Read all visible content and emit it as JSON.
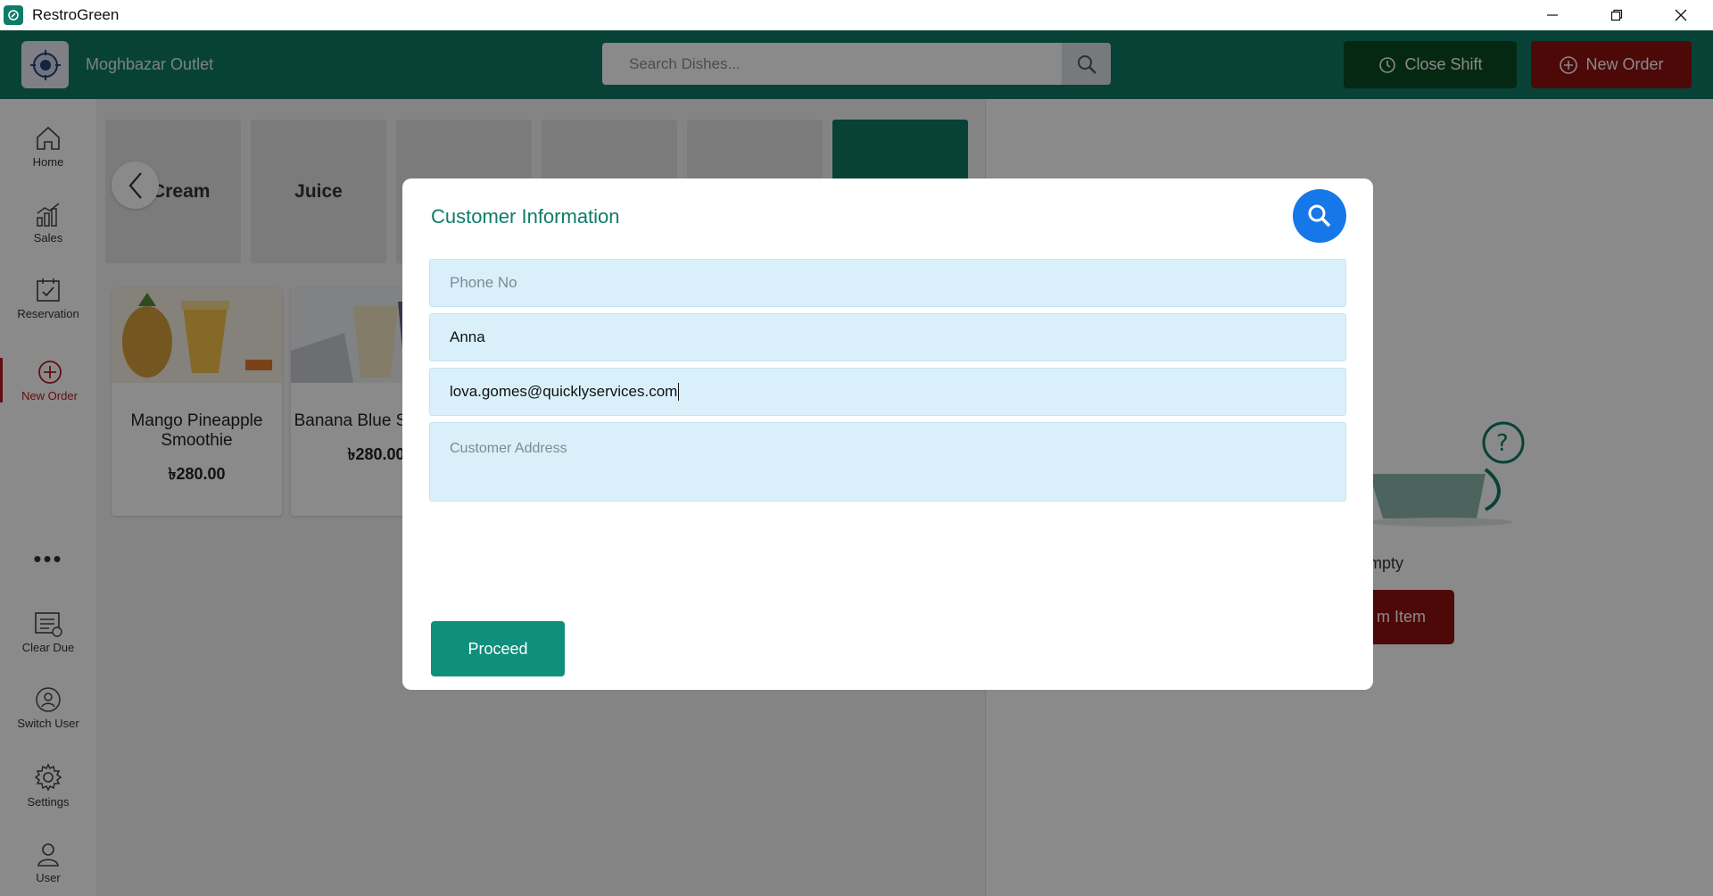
{
  "window": {
    "title": "RestroGreen",
    "controls": [
      "minimize",
      "restore",
      "close"
    ]
  },
  "header": {
    "outlet_name": "Moghbazar Outlet",
    "search_placeholder": "Search Dishes...",
    "close_shift_label": "Close Shift",
    "new_order_label": "New Order"
  },
  "sidebar": {
    "items": [
      {
        "label": "Home",
        "icon": "home-icon"
      },
      {
        "label": "Sales",
        "icon": "chart-icon"
      },
      {
        "label": "Reservation",
        "icon": "calendar-check-icon"
      },
      {
        "label": "New Order",
        "icon": "plus-circle-icon",
        "active": true
      },
      {
        "label": "Clear Due",
        "icon": "receipt-icon"
      },
      {
        "label": "Switch User",
        "icon": "switch-user-icon"
      },
      {
        "label": "Settings",
        "icon": "gear-icon"
      },
      {
        "label": "User",
        "icon": "user-icon"
      }
    ],
    "more": "•••"
  },
  "categories": [
    "e Cream",
    "Juice",
    "",
    "",
    "",
    ""
  ],
  "dishes": [
    {
      "name": "Mango Pineapple Smoothie",
      "price": "৳280.00"
    },
    {
      "name": "Banana Blue Smoothi",
      "price": "৳280.00"
    }
  ],
  "cart": {
    "empty_text": "mpty",
    "add_item_label": "m Item"
  },
  "modal": {
    "title": "Customer Information",
    "phone_placeholder": "Phone No",
    "name_value": "Anna",
    "email_value": "lova.gomes@quicklyservices.com",
    "address_placeholder": "Customer Address",
    "proceed_label": "Proceed"
  },
  "colors": {
    "brand_green": "#0f7a67",
    "danger_red": "#8e0f10",
    "dark_green": "#0b4a24",
    "modal_search_blue": "#1677e8",
    "field_bg": "#d9f0fb"
  }
}
